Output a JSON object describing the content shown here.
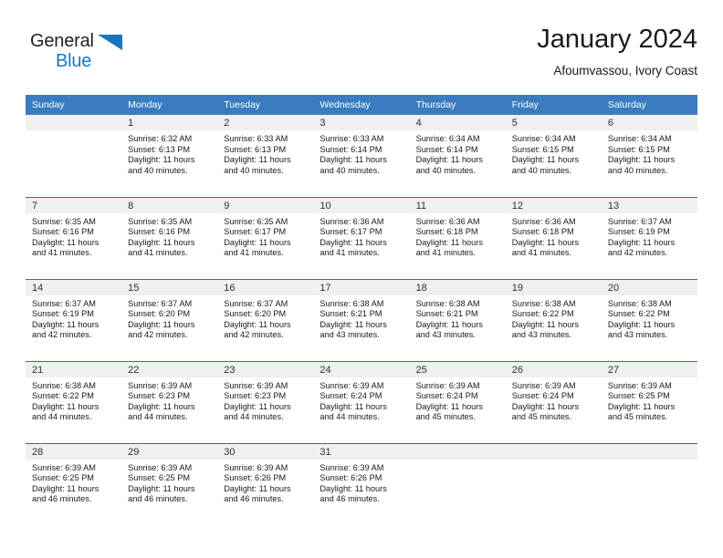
{
  "brand": {
    "line1": "General",
    "line2": "Blue",
    "triangle_icon": "triangle-icon",
    "accent_color": "#1b75bc"
  },
  "header": {
    "title": "January 2024",
    "subtitle": "Afoumvassou, Ivory Coast",
    "header_bg_color": "#3a7cc0",
    "week_rule_color": "#2d6cb3",
    "daynum_band_color": "#f0f0f0"
  },
  "weekday_headers": [
    "Sunday",
    "Monday",
    "Tuesday",
    "Wednesday",
    "Thursday",
    "Friday",
    "Saturday"
  ],
  "labels": {
    "sunrise_prefix": "Sunrise:",
    "sunset_prefix": "Sunset:",
    "daylight_prefix": "Daylight:"
  },
  "weeks": [
    [
      {
        "day": "",
        "sunrise": "",
        "sunset": "",
        "daylight_l1": "",
        "daylight_l2": "",
        "empty": true
      },
      {
        "day": "1",
        "sunrise": "Sunrise: 6:32 AM",
        "sunset": "Sunset: 6:13 PM",
        "daylight_l1": "Daylight: 11 hours",
        "daylight_l2": "and 40 minutes."
      },
      {
        "day": "2",
        "sunrise": "Sunrise: 6:33 AM",
        "sunset": "Sunset: 6:13 PM",
        "daylight_l1": "Daylight: 11 hours",
        "daylight_l2": "and 40 minutes."
      },
      {
        "day": "3",
        "sunrise": "Sunrise: 6:33 AM",
        "sunset": "Sunset: 6:14 PM",
        "daylight_l1": "Daylight: 11 hours",
        "daylight_l2": "and 40 minutes."
      },
      {
        "day": "4",
        "sunrise": "Sunrise: 6:34 AM",
        "sunset": "Sunset: 6:14 PM",
        "daylight_l1": "Daylight: 11 hours",
        "daylight_l2": "and 40 minutes."
      },
      {
        "day": "5",
        "sunrise": "Sunrise: 6:34 AM",
        "sunset": "Sunset: 6:15 PM",
        "daylight_l1": "Daylight: 11 hours",
        "daylight_l2": "and 40 minutes."
      },
      {
        "day": "6",
        "sunrise": "Sunrise: 6:34 AM",
        "sunset": "Sunset: 6:15 PM",
        "daylight_l1": "Daylight: 11 hours",
        "daylight_l2": "and 40 minutes."
      }
    ],
    [
      {
        "day": "7",
        "sunrise": "Sunrise: 6:35 AM",
        "sunset": "Sunset: 6:16 PM",
        "daylight_l1": "Daylight: 11 hours",
        "daylight_l2": "and 41 minutes."
      },
      {
        "day": "8",
        "sunrise": "Sunrise: 6:35 AM",
        "sunset": "Sunset: 6:16 PM",
        "daylight_l1": "Daylight: 11 hours",
        "daylight_l2": "and 41 minutes."
      },
      {
        "day": "9",
        "sunrise": "Sunrise: 6:35 AM",
        "sunset": "Sunset: 6:17 PM",
        "daylight_l1": "Daylight: 11 hours",
        "daylight_l2": "and 41 minutes."
      },
      {
        "day": "10",
        "sunrise": "Sunrise: 6:36 AM",
        "sunset": "Sunset: 6:17 PM",
        "daylight_l1": "Daylight: 11 hours",
        "daylight_l2": "and 41 minutes."
      },
      {
        "day": "11",
        "sunrise": "Sunrise: 6:36 AM",
        "sunset": "Sunset: 6:18 PM",
        "daylight_l1": "Daylight: 11 hours",
        "daylight_l2": "and 41 minutes."
      },
      {
        "day": "12",
        "sunrise": "Sunrise: 6:36 AM",
        "sunset": "Sunset: 6:18 PM",
        "daylight_l1": "Daylight: 11 hours",
        "daylight_l2": "and 41 minutes."
      },
      {
        "day": "13",
        "sunrise": "Sunrise: 6:37 AM",
        "sunset": "Sunset: 6:19 PM",
        "daylight_l1": "Daylight: 11 hours",
        "daylight_l2": "and 42 minutes."
      }
    ],
    [
      {
        "day": "14",
        "sunrise": "Sunrise: 6:37 AM",
        "sunset": "Sunset: 6:19 PM",
        "daylight_l1": "Daylight: 11 hours",
        "daylight_l2": "and 42 minutes."
      },
      {
        "day": "15",
        "sunrise": "Sunrise: 6:37 AM",
        "sunset": "Sunset: 6:20 PM",
        "daylight_l1": "Daylight: 11 hours",
        "daylight_l2": "and 42 minutes."
      },
      {
        "day": "16",
        "sunrise": "Sunrise: 6:37 AM",
        "sunset": "Sunset: 6:20 PM",
        "daylight_l1": "Daylight: 11 hours",
        "daylight_l2": "and 42 minutes."
      },
      {
        "day": "17",
        "sunrise": "Sunrise: 6:38 AM",
        "sunset": "Sunset: 6:21 PM",
        "daylight_l1": "Daylight: 11 hours",
        "daylight_l2": "and 43 minutes."
      },
      {
        "day": "18",
        "sunrise": "Sunrise: 6:38 AM",
        "sunset": "Sunset: 6:21 PM",
        "daylight_l1": "Daylight: 11 hours",
        "daylight_l2": "and 43 minutes."
      },
      {
        "day": "19",
        "sunrise": "Sunrise: 6:38 AM",
        "sunset": "Sunset: 6:22 PM",
        "daylight_l1": "Daylight: 11 hours",
        "daylight_l2": "and 43 minutes."
      },
      {
        "day": "20",
        "sunrise": "Sunrise: 6:38 AM",
        "sunset": "Sunset: 6:22 PM",
        "daylight_l1": "Daylight: 11 hours",
        "daylight_l2": "and 43 minutes."
      }
    ],
    [
      {
        "day": "21",
        "sunrise": "Sunrise: 6:38 AM",
        "sunset": "Sunset: 6:22 PM",
        "daylight_l1": "Daylight: 11 hours",
        "daylight_l2": "and 44 minutes."
      },
      {
        "day": "22",
        "sunrise": "Sunrise: 6:39 AM",
        "sunset": "Sunset: 6:23 PM",
        "daylight_l1": "Daylight: 11 hours",
        "daylight_l2": "and 44 minutes."
      },
      {
        "day": "23",
        "sunrise": "Sunrise: 6:39 AM",
        "sunset": "Sunset: 6:23 PM",
        "daylight_l1": "Daylight: 11 hours",
        "daylight_l2": "and 44 minutes."
      },
      {
        "day": "24",
        "sunrise": "Sunrise: 6:39 AM",
        "sunset": "Sunset: 6:24 PM",
        "daylight_l1": "Daylight: 11 hours",
        "daylight_l2": "and 44 minutes."
      },
      {
        "day": "25",
        "sunrise": "Sunrise: 6:39 AM",
        "sunset": "Sunset: 6:24 PM",
        "daylight_l1": "Daylight: 11 hours",
        "daylight_l2": "and 45 minutes."
      },
      {
        "day": "26",
        "sunrise": "Sunrise: 6:39 AM",
        "sunset": "Sunset: 6:24 PM",
        "daylight_l1": "Daylight: 11 hours",
        "daylight_l2": "and 45 minutes."
      },
      {
        "day": "27",
        "sunrise": "Sunrise: 6:39 AM",
        "sunset": "Sunset: 6:25 PM",
        "daylight_l1": "Daylight: 11 hours",
        "daylight_l2": "and 45 minutes."
      }
    ],
    [
      {
        "day": "28",
        "sunrise": "Sunrise: 6:39 AM",
        "sunset": "Sunset: 6:25 PM",
        "daylight_l1": "Daylight: 11 hours",
        "daylight_l2": "and 46 minutes."
      },
      {
        "day": "29",
        "sunrise": "Sunrise: 6:39 AM",
        "sunset": "Sunset: 6:25 PM",
        "daylight_l1": "Daylight: 11 hours",
        "daylight_l2": "and 46 minutes."
      },
      {
        "day": "30",
        "sunrise": "Sunrise: 6:39 AM",
        "sunset": "Sunset: 6:26 PM",
        "daylight_l1": "Daylight: 11 hours",
        "daylight_l2": "and 46 minutes."
      },
      {
        "day": "31",
        "sunrise": "Sunrise: 6:39 AM",
        "sunset": "Sunset: 6:26 PM",
        "daylight_l1": "Daylight: 11 hours",
        "daylight_l2": "and 46 minutes."
      },
      {
        "day": "",
        "sunrise": "",
        "sunset": "",
        "daylight_l1": "",
        "daylight_l2": "",
        "empty": true
      },
      {
        "day": "",
        "sunrise": "",
        "sunset": "",
        "daylight_l1": "",
        "daylight_l2": "",
        "empty": true
      },
      {
        "day": "",
        "sunrise": "",
        "sunset": "",
        "daylight_l1": "",
        "daylight_l2": "",
        "empty": true
      }
    ]
  ]
}
